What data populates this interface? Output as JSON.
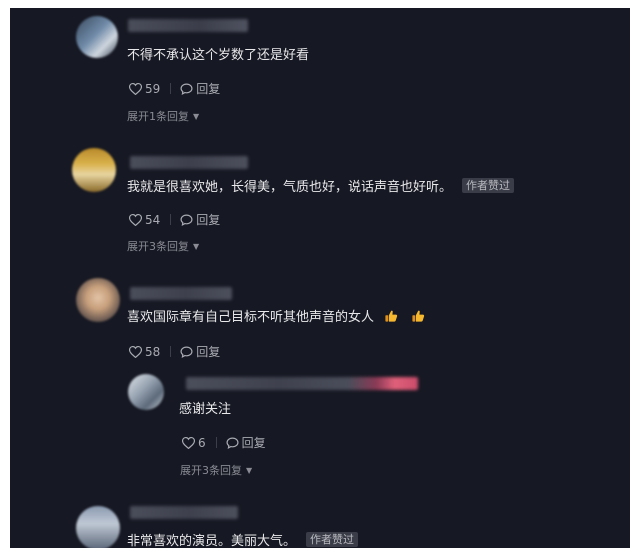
{
  "comments": [
    {
      "text": "不得不承认这个岁数了还是好看",
      "likes": "59",
      "reply_label": "回复",
      "expand_label": "展开1条回复"
    },
    {
      "text": "我就是很喜欢她，长得美，气质也好，说话声音也好听。",
      "badge": "作者赞过",
      "likes": "54",
      "reply_label": "回复",
      "expand_label": "展开3条回复"
    },
    {
      "text": "喜欢国际章有自己目标不听其他声音的女人",
      "emojis": [
        "thumbs-up-icon",
        "thumbs-up-icon"
      ],
      "likes": "58",
      "reply_label": "回复"
    },
    {
      "text": "非常喜欢的演员。美丽大气。",
      "badge": "作者赞过"
    }
  ],
  "reply": {
    "text": "感谢关注",
    "likes": "6",
    "reply_label": "回复",
    "expand_label": "展开3条回复"
  },
  "colors": {
    "background": "#161823",
    "text": "#e8e8ea",
    "meta": "#a9aab2",
    "badge_bg": "#3a3c47",
    "emoji": "#f2a21b"
  }
}
